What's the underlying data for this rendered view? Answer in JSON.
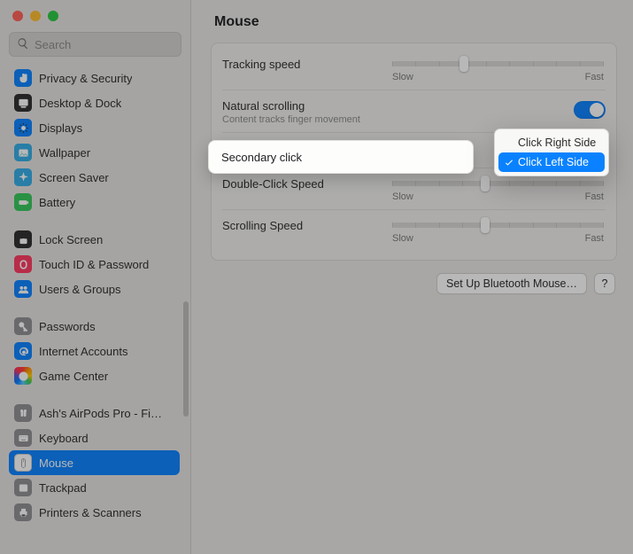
{
  "window": {
    "title": "Mouse"
  },
  "search": {
    "placeholder": "Search"
  },
  "sidebar": {
    "groups": [
      [
        {
          "label": "Privacy & Security",
          "bg": "bg-blue",
          "svg": "hand"
        },
        {
          "label": "Desktop & Dock",
          "bg": "bg-black",
          "svg": "dock"
        },
        {
          "label": "Displays",
          "bg": "bg-blue",
          "svg": "sun"
        },
        {
          "label": "Wallpaper",
          "bg": "bg-cyan",
          "svg": "photo"
        },
        {
          "label": "Screen Saver",
          "bg": "bg-cyan",
          "svg": "sparkle"
        },
        {
          "label": "Battery",
          "bg": "bg-green",
          "svg": "battery"
        }
      ],
      [
        {
          "label": "Lock Screen",
          "bg": "bg-black",
          "svg": "lock"
        },
        {
          "label": "Touch ID & Password",
          "bg": "bg-pink",
          "svg": "finger"
        },
        {
          "label": "Users & Groups",
          "bg": "bg-blue",
          "svg": "users"
        }
      ],
      [
        {
          "label": "Passwords",
          "bg": "bg-gray",
          "svg": "key"
        },
        {
          "label": "Internet Accounts",
          "bg": "bg-blue",
          "svg": "at"
        },
        {
          "label": "Game Center",
          "bg": "bg-multi",
          "svg": "game"
        }
      ],
      [
        {
          "label": "Ash's AirPods Pro - Fi…",
          "bg": "bg-gray",
          "svg": "airpods"
        },
        {
          "label": "Keyboard",
          "bg": "bg-gray",
          "svg": "keyboard"
        },
        {
          "label": "Mouse",
          "bg": "bg-white",
          "svg": "mouse",
          "selected": true
        },
        {
          "label": "Trackpad",
          "bg": "bg-gray",
          "svg": "trackpad"
        },
        {
          "label": "Printers & Scanners",
          "bg": "bg-gray",
          "svg": "printer"
        }
      ]
    ]
  },
  "settings": {
    "tracking": {
      "label": "Tracking speed",
      "min": "Slow",
      "max": "Fast",
      "pos": 0.34
    },
    "natural": {
      "label": "Natural scrolling",
      "sub": "Content tracks finger movement",
      "on": true
    },
    "secondary": {
      "label": "Secondary click"
    },
    "double": {
      "label": "Double-Click Speed",
      "min": "Slow",
      "max": "Fast",
      "pos": 0.44
    },
    "scrolling": {
      "label": "Scrolling Speed",
      "min": "Slow",
      "max": "Fast",
      "pos": 0.44
    }
  },
  "menu": {
    "items": [
      {
        "label": "Click Right Side",
        "selected": false
      },
      {
        "label": "Click Left Side",
        "selected": true
      }
    ]
  },
  "footer": {
    "bluetooth": "Set Up Bluetooth Mouse…",
    "help": "?"
  }
}
